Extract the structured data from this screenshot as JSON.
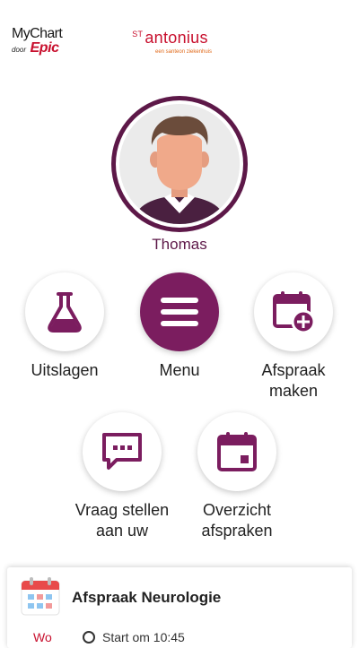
{
  "header": {
    "mychart_label": "MyChart",
    "door_label": "door",
    "epic_label": "Epic",
    "hospital_prefix": "ST",
    "hospital_name": "antonius",
    "hospital_tagline": "een santeon ziekenhuis"
  },
  "user": {
    "name": "Thomas"
  },
  "tiles": [
    {
      "label": "Uitslagen",
      "icon": "flask-icon"
    },
    {
      "label": "Menu",
      "icon": "hamburger-icon"
    },
    {
      "label": "Afspraak maken",
      "icon": "calendar-add-icon"
    },
    {
      "label": "Vraag stellen aan uw",
      "icon": "chat-icon"
    },
    {
      "label": "Overzicht afspraken",
      "icon": "calendar-icon"
    }
  ],
  "appointment": {
    "title": "Afspraak Neurologie",
    "day": "Wo",
    "time": "Start om 10:45"
  },
  "colors": {
    "brand": "#7b1d5f",
    "accent": "#c8102e"
  }
}
